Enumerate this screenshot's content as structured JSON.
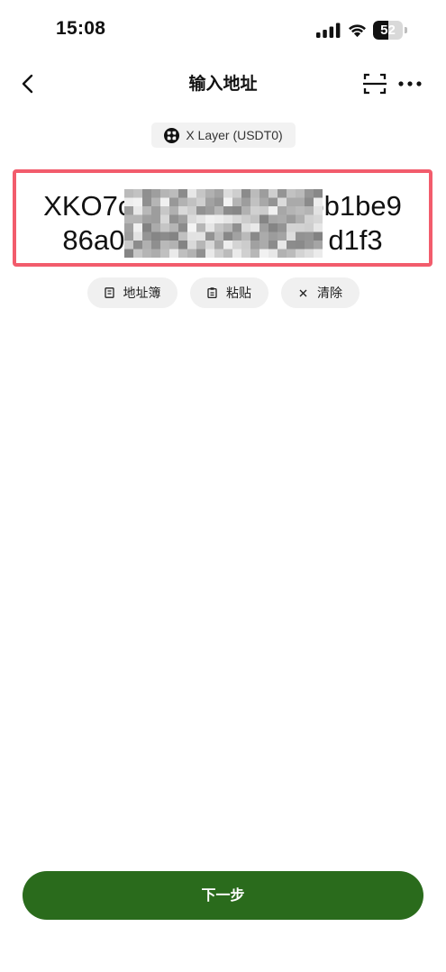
{
  "status_bar": {
    "time": "15:08",
    "battery_level": "52",
    "battery_percent": 52,
    "icons": [
      "signal-icon",
      "wifi-icon",
      "battery-icon"
    ]
  },
  "header": {
    "title": "输入地址",
    "back_icon": "chevron-left-icon",
    "scan_icon": "scan-icon",
    "more_icon": "more-dots-icon"
  },
  "network": {
    "label": "X Layer (USDT0)",
    "icon": "x-layer-logo-icon"
  },
  "address_input": {
    "line1_start": "XKO7c",
    "line1_end": "ob1be9",
    "line2_start": "86a0",
    "line2_end": "d1f3",
    "redacted": true
  },
  "actions": [
    {
      "label": "地址簿",
      "icon": "address-book-icon"
    },
    {
      "label": "粘贴",
      "icon": "clipboard-icon"
    },
    {
      "label": "清除",
      "icon": "clear-x-icon"
    }
  ],
  "next_button": {
    "label": "下一步"
  },
  "colors": {
    "accent": "#2a6b1c",
    "highlight_border": "#f25c6c",
    "chip_background": "#f0f0f0"
  }
}
